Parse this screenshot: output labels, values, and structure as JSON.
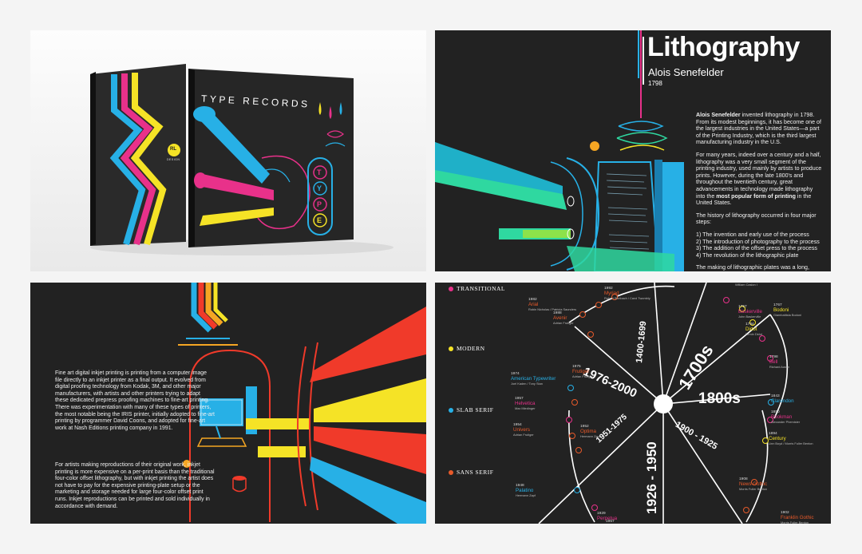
{
  "panel1": {
    "cover_title": "TYPE RECORDS",
    "cover_letters": [
      "T",
      "Y",
      "P",
      "E"
    ],
    "spine_logo": "RL",
    "spine_text": "DESIGN"
  },
  "panel2": {
    "title": "Lithography",
    "subtitle": "Alois Senefelder",
    "year": "1798",
    "para1_bold": "Alois Senefelder",
    "para1": " invented lithography in 1798. From its modest beginnings, it has become one of the largest industries in the United States—a part of the Printing Industry, which is the third largest manufacturing industry in the U.S.",
    "para2_a": "For many years, indeed over a century and a half, lithography was a very small segment of the printing industry, used mainly by artists to produce prints. However, during the late 1800's and throughout the twentieth century, great advancements in technology made lithography into the ",
    "para2_bold": "most popular form of printing",
    "para2_b": " in the United States.",
    "para3": "The history of lithography occurred in four major steps:",
    "steps": [
      "1) The invention and early use of the process",
      "2) The introduction of photography to the process",
      "3) The addition of the offset press to the process",
      "4) The revolution of the lithographic plate"
    ],
    "para4": "The making of lithographic plates was a long,"
  },
  "panel3": {
    "para1": "Fine art digital inkjet printing is printing from a computer image file directly to an inkjet printer as a final output. It evolved from digital proofing technology from Kodak, 3M, and other major manufacturers, with artists and other printers trying to adapt these dedicated prepress proofing machines to fine-art printing. There was experimentation with many of these types of printers, the most notable being the IRIS printer, initially adopted to fine-art printing by programmer David Coons, and adopted for fine-art work at Nash Editions printing company in 1991.",
    "para2": "For artists making reproductions of their original work, inkjet printing is more expensive on a per-print basis than the traditional four-color offset lithography, but with inkjet printing the artist does not have to pay for the expensive printing-plate setup or the marketing and storage needed for large four-color offset print runs. Inkjet reproductions can be printed and sold individually in accordance with demand."
  },
  "panel4": {
    "categories": [
      {
        "name": "TRANSITIONAL",
        "color": "#e8318a"
      },
      {
        "name": "MODERN",
        "color": "#f5e326"
      },
      {
        "name": "SLAB SERIF",
        "color": "#27b0e6"
      },
      {
        "name": "SANS SERIF",
        "color": "#e85a2a"
      }
    ],
    "eras": [
      "1976-2000",
      "1700s",
      "1800s",
      "1951-1975",
      "1900 - 1925",
      "1926 - 1950",
      "1400-1699"
    ],
    "fonts": [
      {
        "year": "1982",
        "name": "Arial",
        "who": "Robin Nicholas / Patricia Saunders",
        "color": "#e85a2a"
      },
      {
        "year": "1992",
        "name": "Myriad",
        "who": "Robert Slimbach / Carol Twombly",
        "color": "#e85a2a"
      },
      {
        "year": "1988",
        "name": "Avenir",
        "who": "Adrian Frutiger",
        "color": "#e85a2a"
      },
      {
        "year": "1757",
        "name": "Baskerville",
        "who": "John Baskerville",
        "color": "#e8318a"
      },
      {
        "year": "1767",
        "name": "Bodoni",
        "who": "Giambattista Bodoni",
        "color": "#f5e326"
      },
      {
        "year": "1784",
        "name": "Didot",
        "who": "Firmin Didot",
        "color": "#f5e326"
      },
      {
        "year": "1798",
        "name": "Bell",
        "who": "Richard Austin",
        "color": "#e8318a"
      },
      {
        "year": "1974",
        "name": "American Typewriter",
        "who": "Joel Kaden / Tony Stan",
        "color": "#27b0e6"
      },
      {
        "year": "1975",
        "name": "Frutiger",
        "who": "Adrian Frutiger",
        "color": "#e85a2a"
      },
      {
        "year": "1957",
        "name": "Helvetica",
        "who": "Max Miedinger",
        "color": "#e8318a"
      },
      {
        "year": "1954",
        "name": "Univers",
        "who": "Adrian Frutiger",
        "color": "#e85a2a"
      },
      {
        "year": "1952",
        "name": "Optima",
        "who": "Hermann Zapf",
        "color": "#e85a2a"
      },
      {
        "year": "1843",
        "name": "Clarendon",
        "who": "",
        "color": "#27b0e6"
      },
      {
        "year": "1850",
        "name": "Bookman",
        "who": "Alexander Phemister",
        "color": "#e8318a"
      },
      {
        "year": "1894",
        "name": "Century",
        "who": "Linn Boyd / Morris Fuller Benton",
        "color": "#f5e326"
      },
      {
        "year": "1908",
        "name": "News Gothic",
        "who": "Morris Fuller Benton",
        "color": "#e85a2a"
      },
      {
        "year": "1948",
        "name": "Palatino",
        "who": "Hermann Zapf",
        "color": "#27b0e6"
      },
      {
        "year": "1902",
        "name": "Franklin Gothic",
        "who": "Morris Fuller Benton",
        "color": "#e85a2a"
      },
      {
        "year": "1929",
        "name": "Perpetua",
        "who": "",
        "color": "#e8318a"
      },
      {
        "year": "1957",
        "name": "",
        "who": "",
        "color": "#27b0e6"
      }
    ],
    "top_author": "William Caslon I"
  }
}
